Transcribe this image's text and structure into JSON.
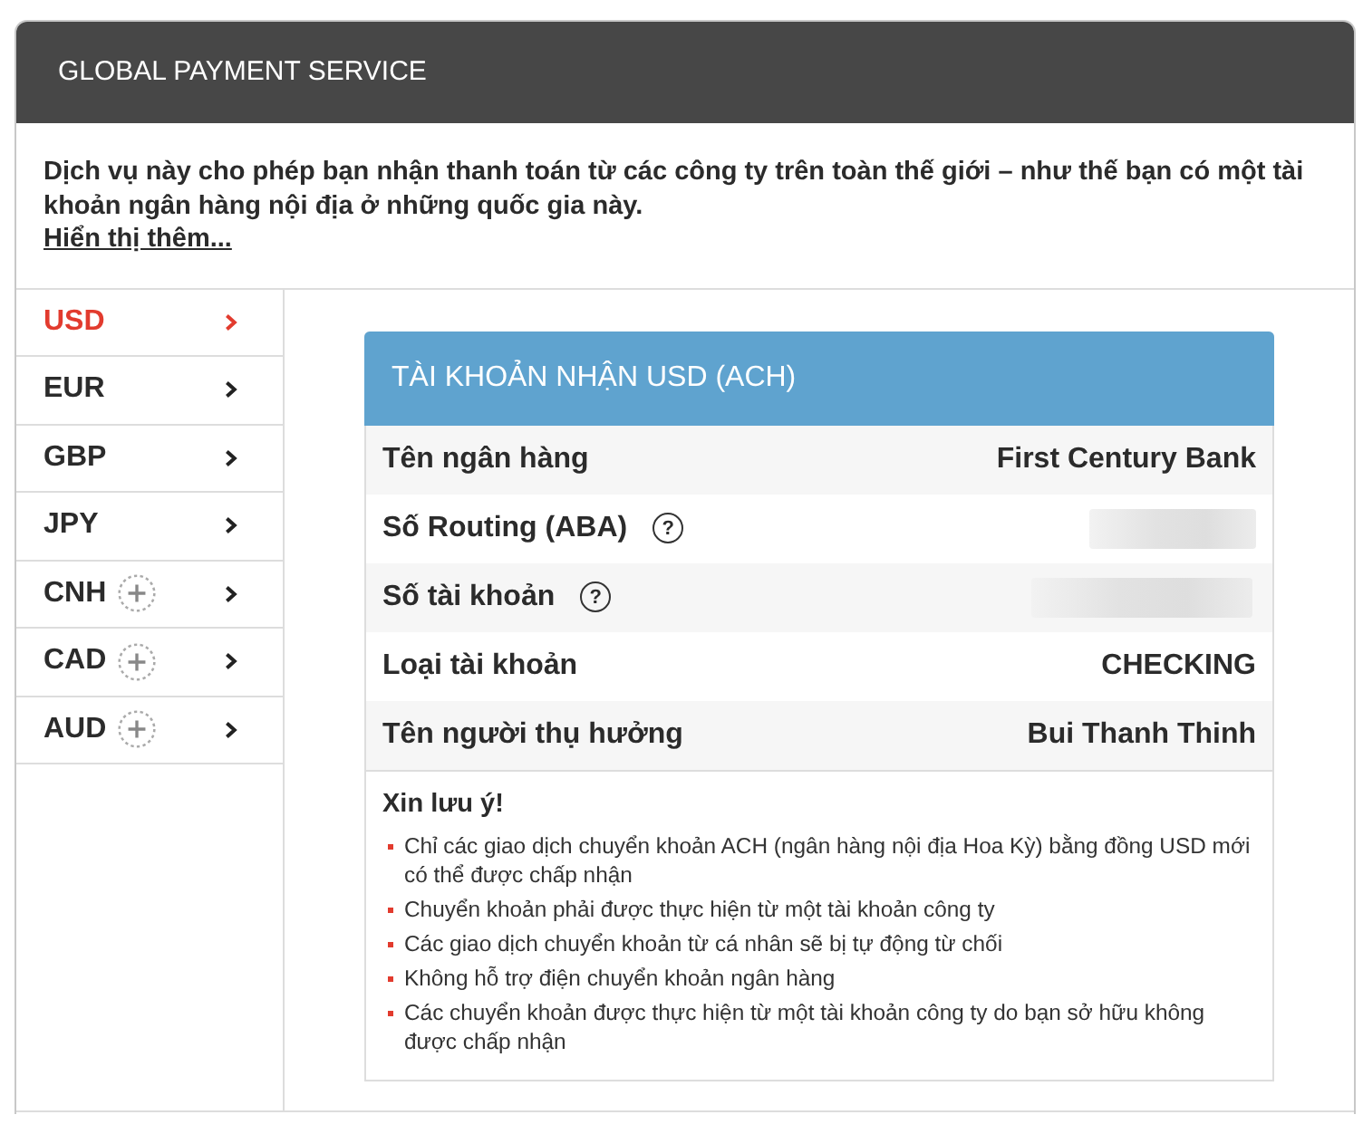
{
  "header": {
    "title": "GLOBAL PAYMENT SERVICE"
  },
  "intro": {
    "text": "Dịch vụ này cho phép bạn nhận thanh toán từ các công ty trên toàn thế giới – như thế bạn có một tài khoản ngân hàng nội địa ở những quốc gia này.",
    "link": "Hiển thị thêm..."
  },
  "currencies": [
    {
      "label": "USD",
      "selected": true,
      "addable": false
    },
    {
      "label": "EUR",
      "selected": false,
      "addable": false
    },
    {
      "label": "GBP",
      "selected": false,
      "addable": false
    },
    {
      "label": "JPY",
      "selected": false,
      "addable": false
    },
    {
      "label": "CNH",
      "selected": false,
      "addable": true
    },
    {
      "label": "CAD",
      "selected": false,
      "addable": true
    },
    {
      "label": "AUD",
      "selected": false,
      "addable": true
    }
  ],
  "account": {
    "title": "TÀI KHOẢN NHẬN USD (ACH)",
    "rows": [
      {
        "label": "Tên ngân hàng",
        "kind": "text",
        "value": "First Century Bank"
      },
      {
        "label": "Số Routing (ABA)",
        "help": "?",
        "kind": "hidden"
      },
      {
        "label": "Số tài khoản",
        "help": "?",
        "kind": "hidden"
      },
      {
        "label": "Loại tài khoản",
        "kind": "text",
        "value": "CHECKING"
      },
      {
        "label": "Tên người thụ hưởng",
        "kind": "text",
        "value": "Bui Thanh Thinh"
      }
    ],
    "notes": {
      "title": "Xin lưu ý!",
      "items": [
        "Chỉ các giao dịch chuyển khoản ACH (ngân hàng nội địa Hoa Kỳ) bằng đồng USD mới có thể được chấp nhận",
        "Chuyển khoản phải được thực hiện từ một tài khoản công ty",
        "Các giao dịch chuyển khoản từ cá nhân sẽ bị tự động từ chối",
        "Không hỗ trợ điện chuyển khoản ngân hàng",
        "Các chuyển khoản được thực hiện từ một tài khoản công ty do bạn sở hữu không được chấp nhận"
      ]
    }
  }
}
